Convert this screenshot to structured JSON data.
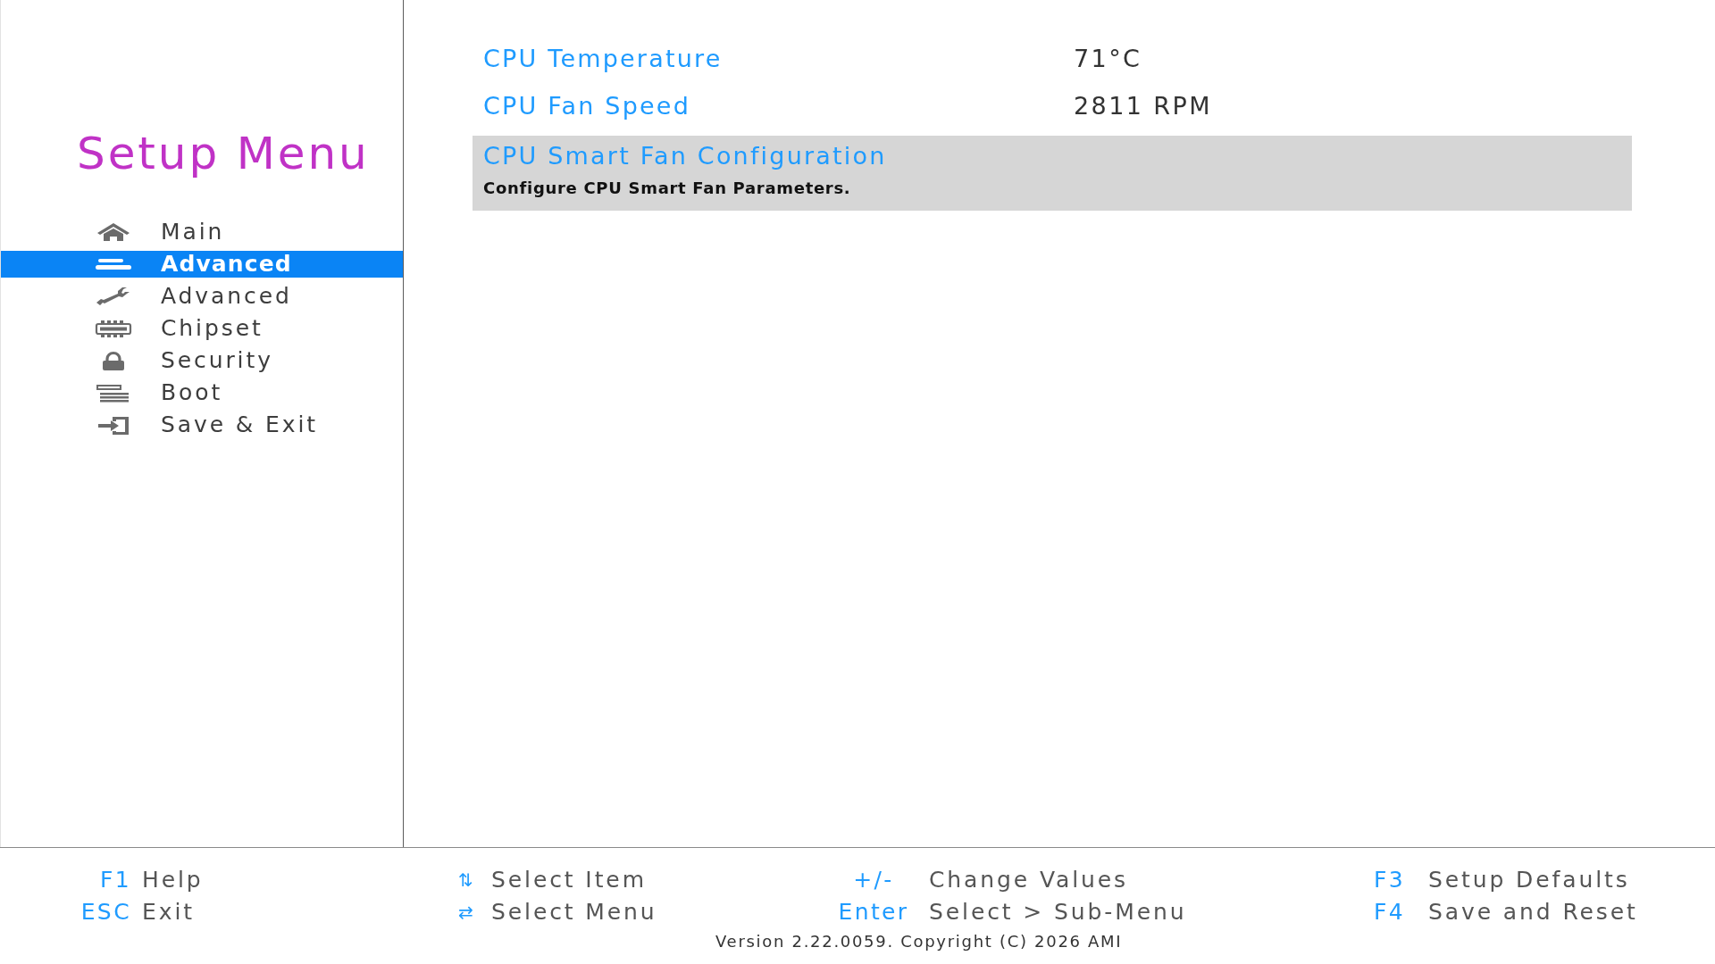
{
  "sidebar": {
    "title": "Setup Menu",
    "items": [
      {
        "label": "Main",
        "selected": false
      },
      {
        "label": "Advanced",
        "selected": true
      },
      {
        "label": "Advanced",
        "selected": false
      },
      {
        "label": "Chipset",
        "selected": false
      },
      {
        "label": "Security",
        "selected": false
      },
      {
        "label": "Boot",
        "selected": false
      },
      {
        "label": "Save & Exit",
        "selected": false
      }
    ]
  },
  "content": {
    "items": [
      {
        "label": "CPU Temperature",
        "value": "71°C",
        "selected": false
      },
      {
        "label": "CPU Fan Speed",
        "value": "2811 RPM",
        "selected": false
      },
      {
        "label": "CPU Smart Fan Configuration",
        "help": "Configure CPU Smart Fan Parameters.",
        "selected": true
      }
    ]
  },
  "footer": {
    "columns": [
      [
        {
          "key": "F1",
          "action": "Help"
        },
        {
          "key": "ESC",
          "action": "Exit"
        }
      ],
      [
        {
          "key": "⇅",
          "action": "Select Item"
        },
        {
          "key": "⇄",
          "action": "Select Menu"
        }
      ],
      [
        {
          "key": "+/-",
          "action": "Change Values"
        },
        {
          "key": "Enter",
          "action": "Select > Sub-Menu"
        }
      ],
      [
        {
          "key": "F3",
          "action": "Setup Defaults"
        },
        {
          "key": "F4",
          "action": "Save and Reset"
        }
      ]
    ],
    "version": "Version 2.22.0059. Copyright (C) 2026 AMI"
  }
}
